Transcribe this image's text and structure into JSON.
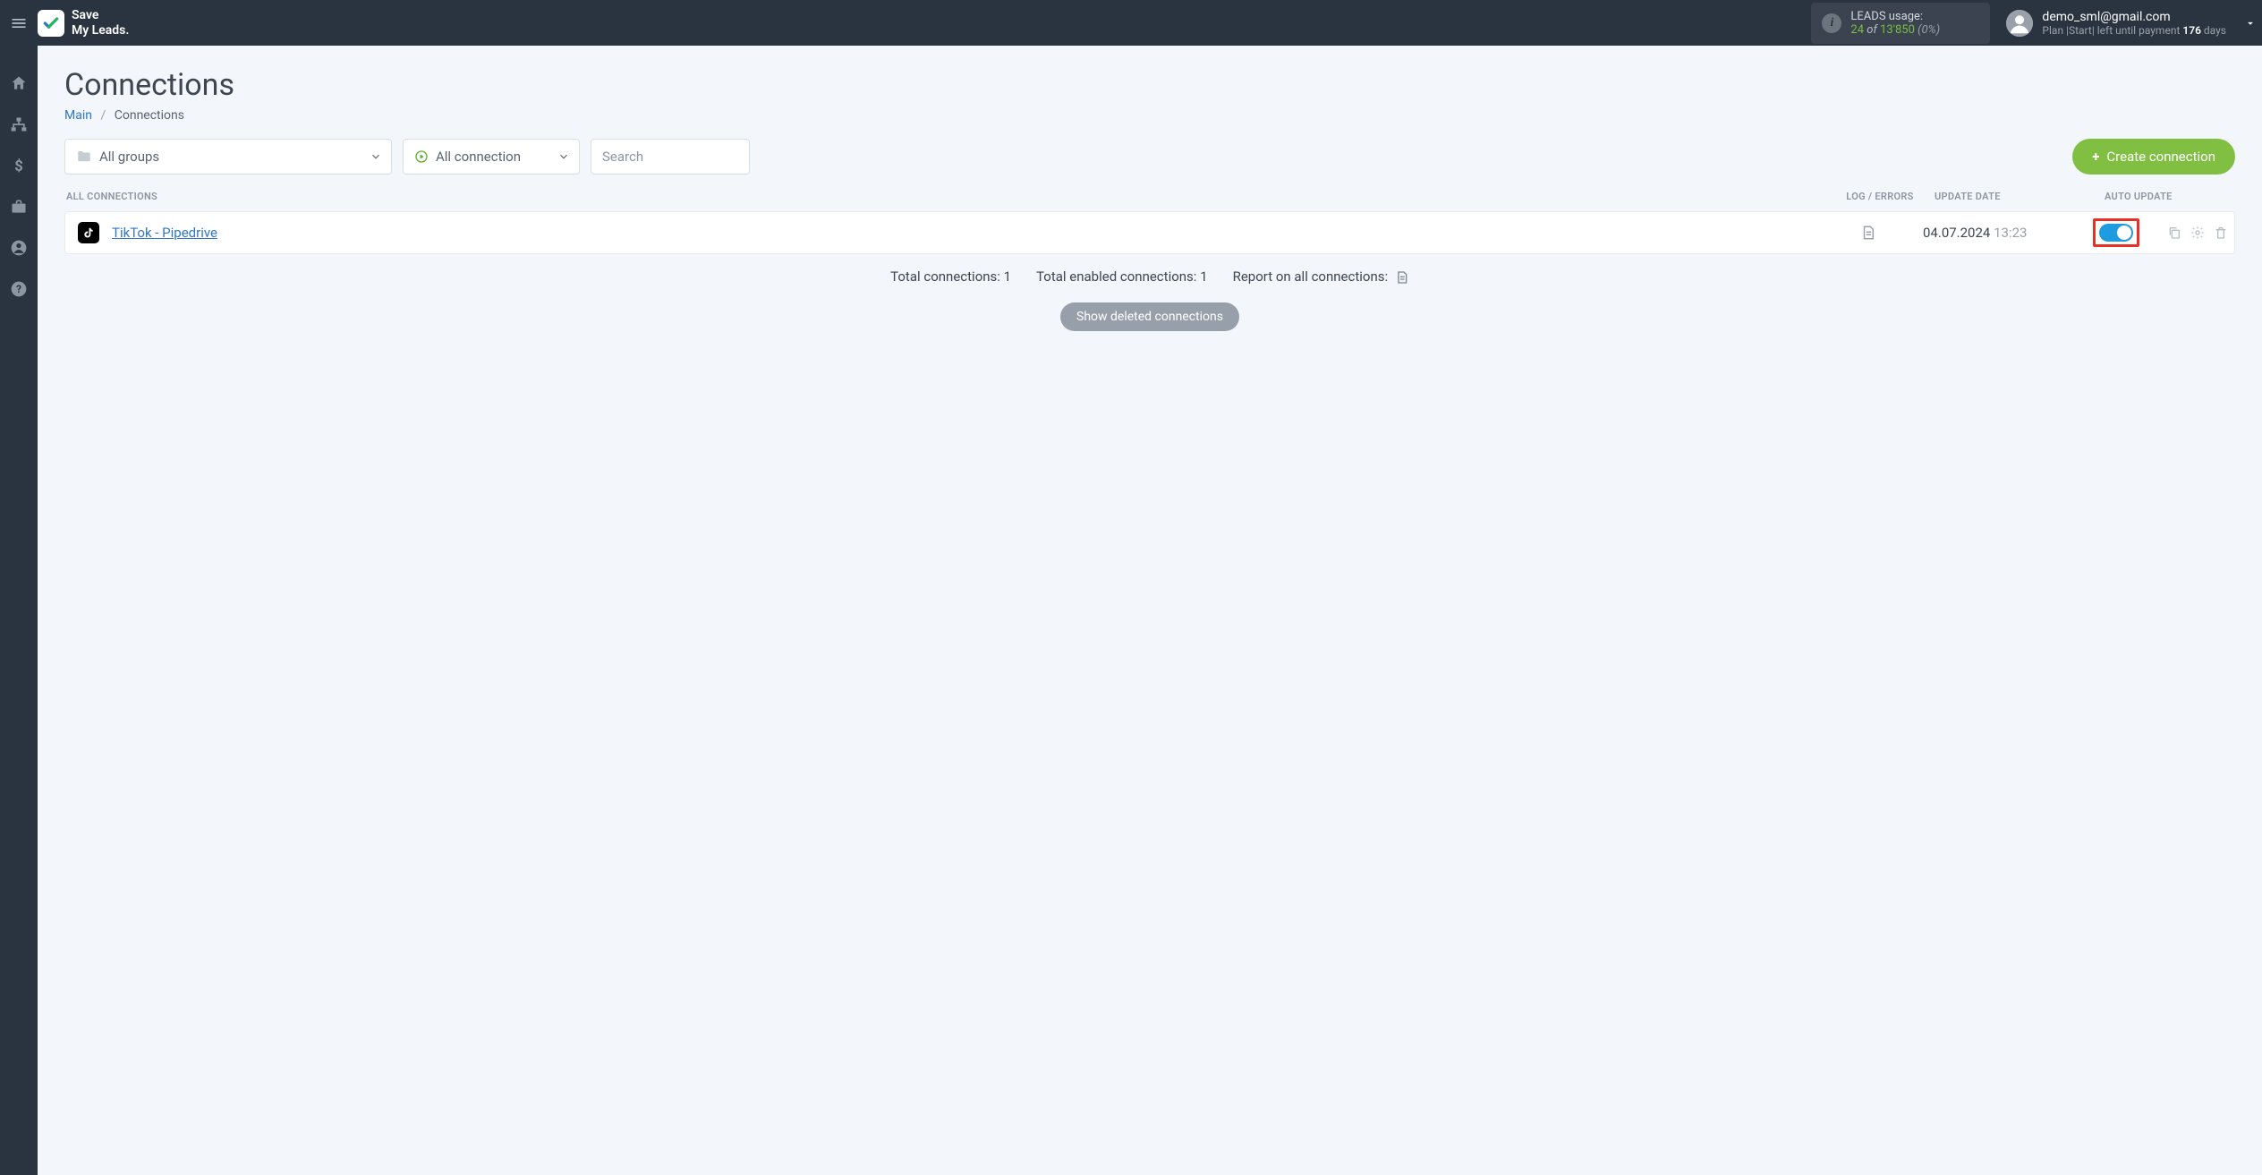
{
  "brand": {
    "line1": "Save",
    "line2": "My Leads."
  },
  "usage": {
    "label": "LEADS usage:",
    "used": "24",
    "of": "of",
    "total": "13'850",
    "pct": "(0%)"
  },
  "user": {
    "email": "demo_sml@gmail.com",
    "plan_prefix": "Plan |Start| left until payment ",
    "days": "176",
    "days_suffix": " days"
  },
  "page": {
    "title": "Connections"
  },
  "breadcrumb": {
    "main": "Main",
    "current": "Connections"
  },
  "filters": {
    "groups": "All groups",
    "connection": "All connection",
    "search_placeholder": "Search"
  },
  "buttons": {
    "create": "Create connection",
    "show_deleted": "Show deleted connections"
  },
  "columns": {
    "all": "All connections",
    "log": "Log / Errors",
    "date": "Update date",
    "auto": "Auto update"
  },
  "rows": [
    {
      "name": "TikTok - Pipedrive",
      "date": "04.07.2024",
      "time": "13:23",
      "auto": true
    }
  ],
  "summary": {
    "total": "Total connections: 1",
    "enabled": "Total enabled connections: 1",
    "report": "Report on all connections:"
  }
}
